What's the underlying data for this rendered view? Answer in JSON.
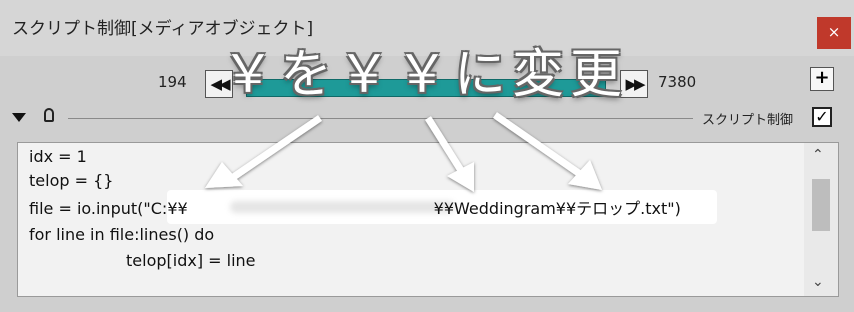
{
  "window": {
    "title": "スクリプト制御[メディアオブジェクト]",
    "close_symbol": "×"
  },
  "timeline": {
    "start_frame": "194",
    "end_frame": "7380",
    "prev_symbol": "◀◀",
    "next_symbol": "▶▶",
    "add_symbol": "+"
  },
  "section": {
    "label": "スクリプト制御",
    "checked_symbol": "✓"
  },
  "code": {
    "line1": "idx = 1",
    "line2": "telop = {}",
    "line3_prefix": "file = io.input(\"",
    "line3_path_start": "C:¥¥",
    "line3_path_end": "¥¥Weddingram¥¥テロップ.txt",
    "line3_suffix": "\")",
    "line4": "for line in file:lines() do",
    "line5": "telop[idx] = line"
  },
  "scrollbar": {
    "up_symbol": "⌃",
    "down_symbol": "⌄"
  },
  "annotation": {
    "text": "￥を￥￥に変更",
    "color": "#ffffff"
  },
  "colors": {
    "seekbar": "#1e9a98",
    "close_button": "#c0392b"
  }
}
